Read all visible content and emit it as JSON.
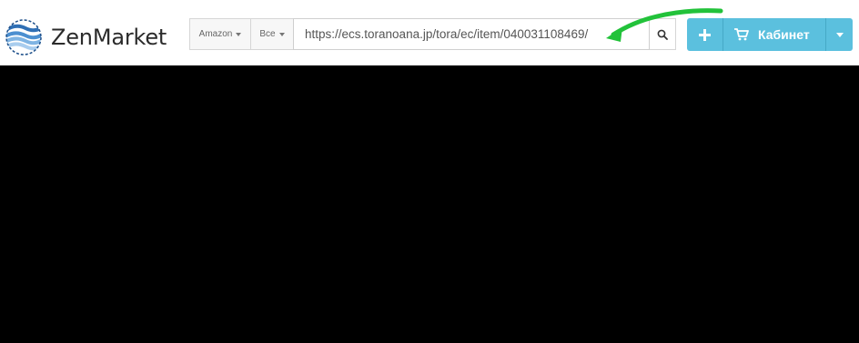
{
  "app": {
    "name": "ZenMarket"
  },
  "search": {
    "store_label": "Amazon",
    "category_label": "Все",
    "query": "https://ecs.toranoana.jp/tora/ec/item/040031108469/"
  },
  "icons": {
    "logo": "zenmarket-logo-icon",
    "search": "search-icon",
    "plus": "plus-icon",
    "cart": "cart-icon",
    "dropdown": "chevron-down-icon"
  },
  "actions": {
    "cabinet_label": "Кабинет"
  },
  "colors": {
    "accent": "#5bc0de",
    "annotation_arrow": "#22c23a",
    "page_background": "#000000"
  }
}
